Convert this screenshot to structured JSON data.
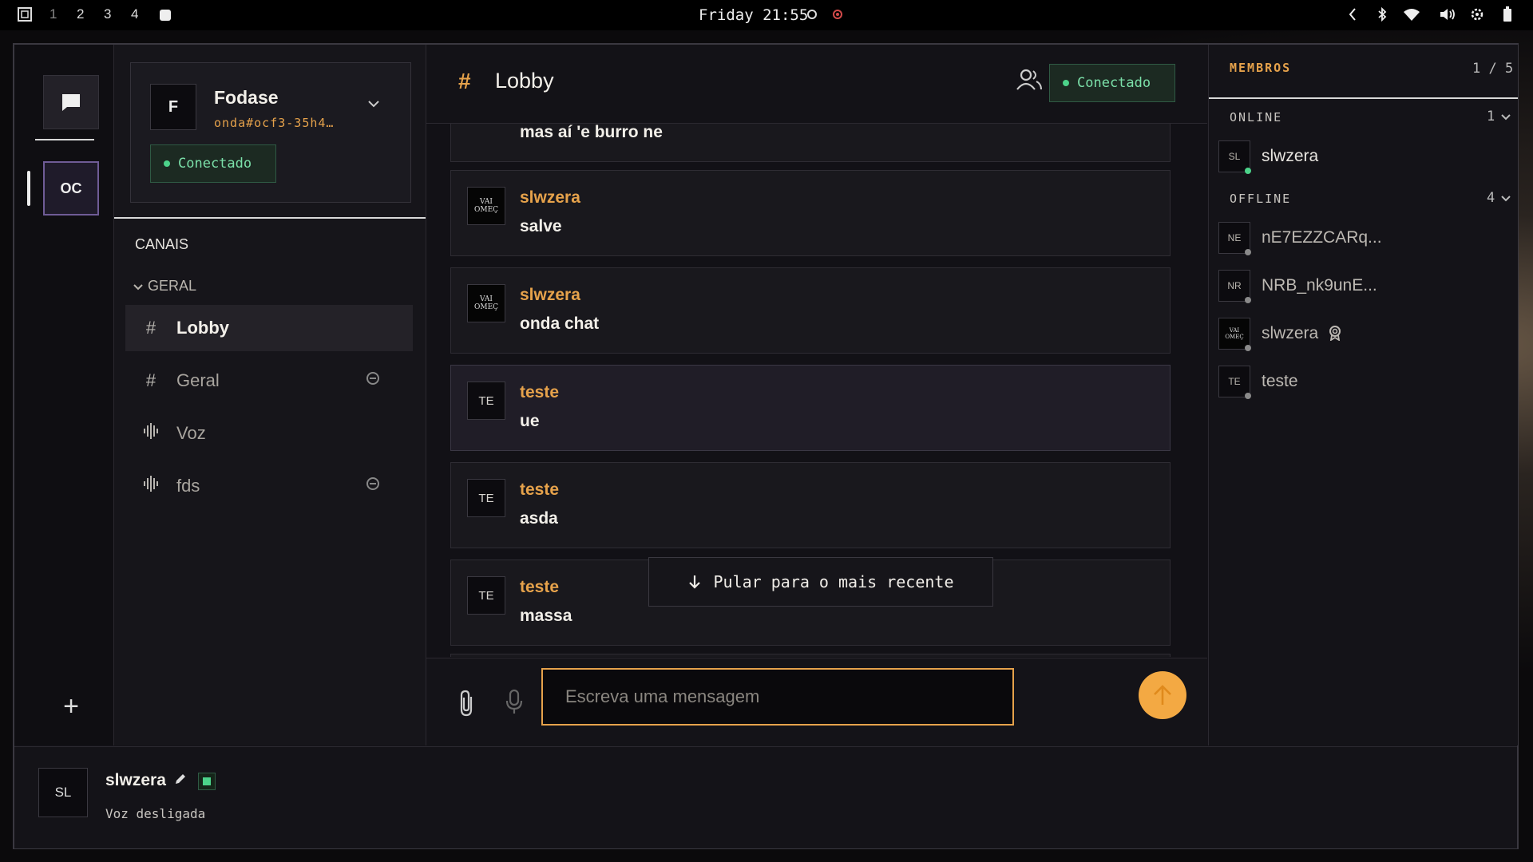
{
  "system_bar": {
    "workspaces": [
      "1",
      "2",
      "3",
      "4"
    ],
    "clock": "Friday 21:55"
  },
  "rail": {
    "server_initials": "OC"
  },
  "server": {
    "initial": "F",
    "name": "Fodase",
    "handle": "onda#ocf3-35h4…",
    "status": "Conectado"
  },
  "channels": {
    "heading": "CANAIS",
    "category": "GERAL",
    "items": [
      {
        "label": "Lobby",
        "icon": "hash-icon"
      },
      {
        "label": "Geral",
        "icon": "hash-icon"
      },
      {
        "label": "Voz",
        "icon": "voice-icon"
      },
      {
        "label": "fds",
        "icon": "voice-icon"
      }
    ]
  },
  "chat": {
    "title": "Lobby",
    "status": "Conectado",
    "partial_message": "mas aí 'e burro ne",
    "messages": [
      {
        "author": "slwzera",
        "text": "salve",
        "avatar": "image"
      },
      {
        "author": "slwzera",
        "text": "onda chat",
        "avatar": "image"
      },
      {
        "author": "teste",
        "text": "ue",
        "avatar": "TE"
      },
      {
        "author": "teste",
        "text": "asda",
        "avatar": "TE"
      },
      {
        "author": "teste",
        "text": "massa",
        "avatar": "TE"
      }
    ],
    "jump_label": "Pular para o mais recente",
    "input_placeholder": "Escreva uma mensagem"
  },
  "members": {
    "title": "MEMBROS",
    "count": "1 / 5",
    "online_label": "ONLINE",
    "online_count": "1",
    "offline_label": "OFFLINE",
    "offline_count": "4",
    "online": [
      {
        "initials": "SL",
        "name": "slwzera"
      }
    ],
    "offline": [
      {
        "initials": "NE",
        "name": "nE7EZZCARq..."
      },
      {
        "initials": "NR",
        "name": "NRB_nk9unE..."
      },
      {
        "initials": "",
        "name": "slwzera",
        "avatar": "image"
      },
      {
        "initials": "TE",
        "name": "teste"
      }
    ]
  },
  "user": {
    "initials": "SL",
    "name": "slwzera",
    "voice_status": "Voz desligada"
  },
  "colors": {
    "accent": "#e6a24b",
    "online": "#4cd38a",
    "send_button": "#f3a943"
  }
}
